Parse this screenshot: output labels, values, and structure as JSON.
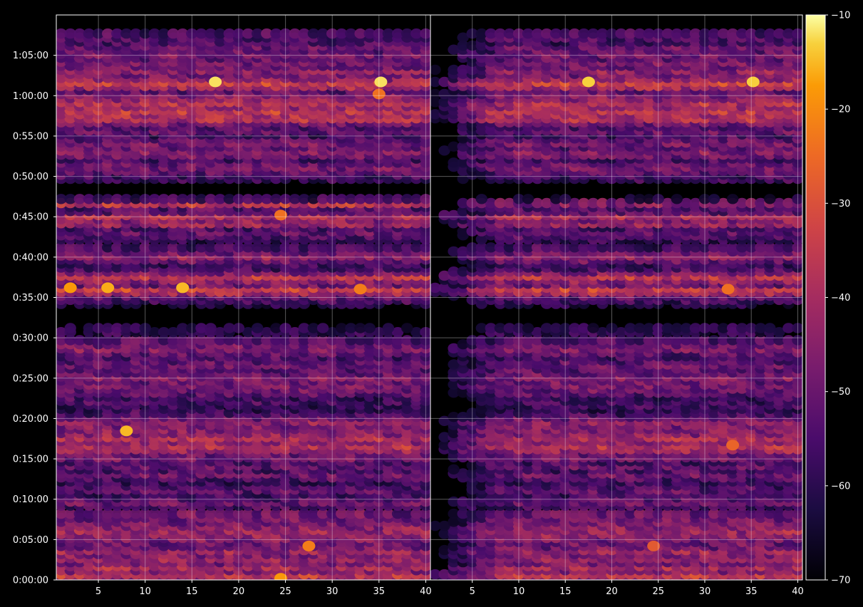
{
  "chart_data": {
    "type": "heatmap",
    "title": "",
    "xlabel": "",
    "ylabel": "",
    "panels": [
      {
        "name": "",
        "xlim": [
          1,
          40
        ],
        "x_ticks": [
          5,
          10,
          15,
          20,
          25,
          30,
          35,
          40
        ]
      },
      {
        "name": "",
        "xlim": [
          1,
          40
        ],
        "x_ticks": [
          5,
          10,
          15,
          20,
          25,
          30,
          35,
          40
        ]
      }
    ],
    "ylim_seconds": [
      0,
      4200
    ],
    "y_ticks": [
      {
        "value": 0,
        "label": "0:00:00"
      },
      {
        "value": 300,
        "label": "0:05:00"
      },
      {
        "value": 600,
        "label": "0:10:00"
      },
      {
        "value": 900,
        "label": "0:15:00"
      },
      {
        "value": 1200,
        "label": "0:20:00"
      },
      {
        "value": 1500,
        "label": "0:25:00"
      },
      {
        "value": 1800,
        "label": "0:30:00"
      },
      {
        "value": 2100,
        "label": "0:35:00"
      },
      {
        "value": 2400,
        "label": "0:40:00"
      },
      {
        "value": 2700,
        "label": "0:45:00"
      },
      {
        "value": 3000,
        "label": "0:50:00"
      },
      {
        "value": 3300,
        "label": "0:55:00"
      },
      {
        "value": 3600,
        "label": "1:00:00"
      },
      {
        "value": 3900,
        "label": "1:05:00"
      }
    ],
    "grid": true,
    "colorbar": {
      "range": [
        -70,
        -10
      ],
      "ticks": [
        -10,
        -20,
        -30,
        -40,
        -50,
        -60,
        -70
      ],
      "tick_labels": [
        "−10",
        "−20",
        "−30",
        "−40",
        "−50",
        "−60",
        "−70"
      ],
      "colormap": "inferno"
    },
    "rows": [
      {
        "t": 12,
        "v": -44
      },
      {
        "t": 42,
        "v": -36
      },
      {
        "t": 72,
        "v": -46
      },
      {
        "t": 102,
        "v": -40
      },
      {
        "t": 132,
        "v": -48
      },
      {
        "t": 162,
        "v": -43
      },
      {
        "t": 192,
        "v": -47
      },
      {
        "t": 222,
        "v": -42
      },
      {
        "t": 252,
        "v": -49
      },
      {
        "t": 282,
        "v": -50
      },
      {
        "t": 312,
        "v": -47
      },
      {
        "t": 342,
        "v": -44
      },
      {
        "t": 372,
        "v": -42
      },
      {
        "t": 402,
        "v": -45
      },
      {
        "t": 432,
        "v": -48
      },
      {
        "t": 462,
        "v": -49
      },
      {
        "t": 492,
        "v": -50
      },
      {
        "t": 552,
        "v": -55
      },
      {
        "t": 582,
        "v": -50
      },
      {
        "t": 612,
        "v": -53
      },
      {
        "t": 642,
        "v": -57
      },
      {
        "t": 672,
        "v": -52
      },
      {
        "t": 702,
        "v": -55
      },
      {
        "t": 732,
        "v": -58
      },
      {
        "t": 762,
        "v": -54
      },
      {
        "t": 792,
        "v": -50
      },
      {
        "t": 822,
        "v": -55
      },
      {
        "t": 852,
        "v": -51
      },
      {
        "t": 882,
        "v": -55
      },
      {
        "t": 912,
        "v": -48
      },
      {
        "t": 942,
        "v": -50
      },
      {
        "t": 972,
        "v": -42
      },
      {
        "t": 1002,
        "v": -38
      },
      {
        "t": 1032,
        "v": -44
      },
      {
        "t": 1062,
        "v": -38
      },
      {
        "t": 1092,
        "v": -45
      },
      {
        "t": 1122,
        "v": -46
      },
      {
        "t": 1152,
        "v": -47
      },
      {
        "t": 1182,
        "v": -44
      },
      {
        "t": 1212,
        "v": -50
      },
      {
        "t": 1242,
        "v": -56
      },
      {
        "t": 1272,
        "v": -62
      },
      {
        "t": 1302,
        "v": -58
      },
      {
        "t": 1332,
        "v": -56
      },
      {
        "t": 1362,
        "v": -57
      },
      {
        "t": 1392,
        "v": -52
      },
      {
        "t": 1422,
        "v": -50
      },
      {
        "t": 1452,
        "v": -48
      },
      {
        "t": 1482,
        "v": -50
      },
      {
        "t": 1512,
        "v": -46
      },
      {
        "t": 1542,
        "v": -50
      },
      {
        "t": 1572,
        "v": -53
      },
      {
        "t": 1602,
        "v": -50
      },
      {
        "t": 1632,
        "v": -52
      },
      {
        "t": 1662,
        "v": -55
      },
      {
        "t": 1692,
        "v": -52
      },
      {
        "t": 1722,
        "v": -46
      },
      {
        "t": 1752,
        "v": -50
      },
      {
        "t": 1782,
        "v": -54
      },
      {
        "t": 1842,
        "v": -60
      },
      {
        "t": 1872,
        "v": -62
      },
      {
        "t": 2052,
        "v": -62
      },
      {
        "t": 2082,
        "v": -56
      },
      {
        "t": 2112,
        "v": -52
      },
      {
        "t": 2142,
        "v": -40
      },
      {
        "t": 2172,
        "v": -34
      },
      {
        "t": 2202,
        "v": -50
      },
      {
        "t": 2232,
        "v": -44
      },
      {
        "t": 2262,
        "v": -36
      },
      {
        "t": 2292,
        "v": -48
      },
      {
        "t": 2322,
        "v": -56
      },
      {
        "t": 2352,
        "v": -58
      },
      {
        "t": 2382,
        "v": -50
      },
      {
        "t": 2412,
        "v": -44
      },
      {
        "t": 2442,
        "v": -50
      },
      {
        "t": 2472,
        "v": -56
      },
      {
        "t": 2532,
        "v": -58
      },
      {
        "t": 2562,
        "v": -54
      },
      {
        "t": 2592,
        "v": -52
      },
      {
        "t": 2622,
        "v": -55
      },
      {
        "t": 2652,
        "v": -42
      },
      {
        "t": 2682,
        "v": -46
      },
      {
        "t": 2712,
        "v": -38
      },
      {
        "t": 2742,
        "v": -52
      },
      {
        "t": 2772,
        "v": -54
      },
      {
        "t": 2802,
        "v": -36
      },
      {
        "t": 2832,
        "v": -56
      },
      {
        "t": 2982,
        "v": -58
      },
      {
        "t": 3012,
        "v": -56
      },
      {
        "t": 3042,
        "v": -52
      },
      {
        "t": 3072,
        "v": -48
      },
      {
        "t": 3102,
        "v": -50
      },
      {
        "t": 3132,
        "v": -56
      },
      {
        "t": 3162,
        "v": -48
      },
      {
        "t": 3192,
        "v": -46
      },
      {
        "t": 3222,
        "v": -52
      },
      {
        "t": 3252,
        "v": -48
      },
      {
        "t": 3282,
        "v": -52
      },
      {
        "t": 3312,
        "v": -56
      },
      {
        "t": 3342,
        "v": -50
      },
      {
        "t": 3372,
        "v": -54
      },
      {
        "t": 3402,
        "v": -48
      },
      {
        "t": 3432,
        "v": -38
      },
      {
        "t": 3462,
        "v": -40
      },
      {
        "t": 3492,
        "v": -36
      },
      {
        "t": 3522,
        "v": -42
      },
      {
        "t": 3552,
        "v": -38
      },
      {
        "t": 3582,
        "v": -44
      },
      {
        "t": 3612,
        "v": -46
      },
      {
        "t": 3642,
        "v": -52
      },
      {
        "t": 3672,
        "v": -40
      },
      {
        "t": 3702,
        "v": -34
      },
      {
        "t": 3732,
        "v": -44
      },
      {
        "t": 3762,
        "v": -48
      },
      {
        "t": 3792,
        "v": -44
      },
      {
        "t": 3822,
        "v": -50
      },
      {
        "t": 3852,
        "v": -48
      },
      {
        "t": 3882,
        "v": -52
      },
      {
        "t": 3912,
        "v": -48
      },
      {
        "t": 3942,
        "v": -52
      },
      {
        "t": 3972,
        "v": -50
      },
      {
        "t": 4002,
        "v": -56
      },
      {
        "t": 4032,
        "v": -55
      },
      {
        "t": 4062,
        "v": -55
      }
    ],
    "hot_spots": [
      {
        "panel": 0,
        "x": 2,
        "t": 2172,
        "v": -18
      },
      {
        "panel": 0,
        "x": 6,
        "t": 2172,
        "v": -16
      },
      {
        "panel": 0,
        "x": 14,
        "t": 2172,
        "v": -15
      },
      {
        "panel": 0,
        "x": 33,
        "t": 2162,
        "v": -22
      },
      {
        "panel": 0,
        "x": 8,
        "t": 1108,
        "v": -15
      },
      {
        "panel": 0,
        "x": 17.5,
        "t": 3702,
        "v": -12
      },
      {
        "panel": 0,
        "x": 35.2,
        "t": 3702,
        "v": -12
      },
      {
        "panel": 0,
        "x": 24.5,
        "t": 2712,
        "v": -24
      },
      {
        "panel": 0,
        "x": 24.5,
        "t": 12,
        "v": -18
      },
      {
        "panel": 0,
        "x": 27.5,
        "t": 252,
        "v": -22
      },
      {
        "panel": 0,
        "x": 35,
        "t": 3612,
        "v": -24
      },
      {
        "panel": 1,
        "x": 17.5,
        "t": 3702,
        "v": -13
      },
      {
        "panel": 1,
        "x": 35.2,
        "t": 3702,
        "v": -13
      },
      {
        "panel": 1,
        "x": 32.5,
        "t": 2162,
        "v": -24
      },
      {
        "panel": 1,
        "x": 33,
        "t": 1002,
        "v": -26
      },
      {
        "panel": 1,
        "x": 24.5,
        "t": 252,
        "v": -28
      }
    ]
  }
}
